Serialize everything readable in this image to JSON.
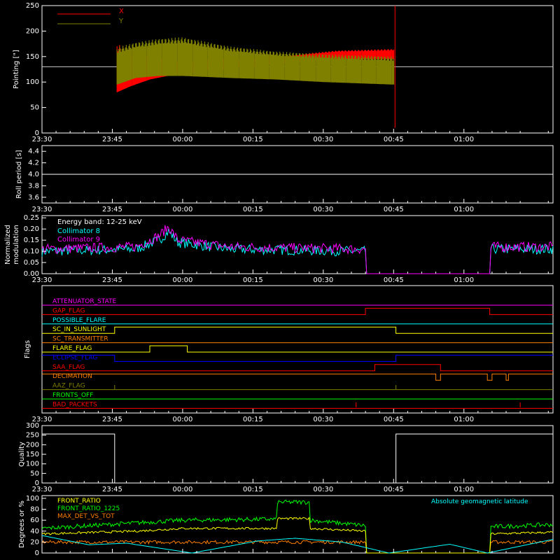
{
  "time_ticks": [
    "23:30",
    "23:45",
    "00:00",
    "00:15",
    "00:30",
    "00:45",
    "01:00"
  ],
  "panels": {
    "pointing": {
      "ylabel": "Pointing [\"]",
      "yticks": [
        "0",
        "50",
        "100",
        "150",
        "200",
        "250"
      ],
      "legend": [
        {
          "name": "X",
          "color": "#ff0000"
        },
        {
          "name": "Y",
          "color": "#7f7f00"
        }
      ]
    },
    "roll": {
      "ylabel": "Roll period [s]",
      "yticks": [
        "3.6",
        "3.8",
        "4.0",
        "4.2",
        "4.4"
      ]
    },
    "modulation": {
      "ylabel_line1": "Normalized",
      "ylabel_line2": "modulation",
      "yticks": [
        "0.00",
        "0.05",
        "0.10",
        "0.15",
        "0.20",
        "0.25"
      ],
      "energy_band": "Energy band: 12-25 keV",
      "legend": [
        {
          "name": "Collimator 8",
          "color": "#00ffff"
        },
        {
          "name": "Collimator 9",
          "color": "#ff00ff"
        }
      ]
    },
    "flags": {
      "ylabel": "Flags",
      "items": [
        {
          "label": "ATTENUATOR_STATE",
          "color": "#ff00ff"
        },
        {
          "label": "GAP_FLAG",
          "color": "#ff0000"
        },
        {
          "label": "POSSIBLE_FLARE",
          "color": "#00ffff"
        },
        {
          "label": "SC_IN_SUNLIGHT",
          "color": "#ffff00"
        },
        {
          "label": "SC_TRANSMITTER",
          "color": "#ff7f00"
        },
        {
          "label": "FLARE_FLAG",
          "color": "#ffff00"
        },
        {
          "label": "ECLIPSE_FLAG",
          "color": "#0000ff"
        },
        {
          "label": "SAA_FLAG",
          "color": "#ff0000"
        },
        {
          "label": "DECIMATION",
          "color": "#ff7f00"
        },
        {
          "label": "AAZ_FLAG",
          "color": "#7f7f00"
        },
        {
          "label": "FRONTS_OFF",
          "color": "#00ff00"
        },
        {
          "label": "BAD_PACKETS",
          "color": "#ff0000"
        }
      ]
    },
    "quality": {
      "ylabel": "Quality",
      "yticks": [
        "0",
        "50",
        "100",
        "150",
        "200",
        "250",
        "300"
      ]
    },
    "ratios": {
      "ylabel": "Degrees or %",
      "yticks": [
        "0",
        "20",
        "40",
        "60",
        "80",
        "100"
      ],
      "legend": [
        {
          "name": "FRONT_RATIO",
          "color": "#ffff00"
        },
        {
          "name": "FRONT_RATIO_1225",
          "color": "#00ff00"
        },
        {
          "name": "MAX_DET_VS_TOT",
          "color": "#ff7f00"
        }
      ],
      "right_legend": {
        "name": "Absolute geomagnetic latitude",
        "color": "#00ffff"
      }
    }
  },
  "chart_data": [
    {
      "type": "line",
      "title": "",
      "ylabel": "Pointing [\"]",
      "ylim": [
        0,
        250
      ],
      "x_range_minutes": [
        -30,
        79
      ],
      "series": [
        {
          "name": "X",
          "color": "#ff0000",
          "envelope": [
            [
              -14,
              80,
              175
            ],
            [
              -11,
              92,
              162
            ],
            [
              -7,
              105,
              150
            ],
            [
              0,
              118,
              142
            ],
            [
              15,
              130,
              148
            ],
            [
              25,
              140,
              155
            ],
            [
              33,
              145,
              162
            ],
            [
              45,
              145,
              165
            ]
          ]
        },
        {
          "name": "Y",
          "color": "#7f7f00",
          "envelope": [
            [
              -14,
              95,
              168
            ],
            [
              -10,
              108,
              178
            ],
            [
              -5,
              112,
              185
            ],
            [
              0,
              112,
              188
            ],
            [
              10,
              108,
              170
            ],
            [
              20,
              105,
              160
            ],
            [
              30,
              100,
              155
            ],
            [
              45,
              95,
              150
            ]
          ]
        }
      ],
      "reference_line": 130
    },
    {
      "type": "line",
      "ylabel": "Roll period [s]",
      "ylim": [
        3.5,
        4.5
      ],
      "series": [
        {
          "name": "",
          "values_const": 4.0
        }
      ]
    },
    {
      "type": "line",
      "ylabel": "Normalized modulation",
      "ylim": [
        0,
        0.25
      ],
      "series": [
        {
          "name": "Collimator 8",
          "color": "#00ffff",
          "base": [
            [
              -30,
              0.1
            ],
            [
              -10,
              0.11
            ],
            [
              -5,
              0.15
            ],
            [
              -3,
              0.19
            ],
            [
              -1,
              0.14
            ],
            [
              10,
              0.11
            ],
            [
              39,
              0.1
            ],
            [
              39.2,
              0
            ],
            [
              65.5,
              0
            ],
            [
              65.7,
              0.11
            ],
            [
              79,
              0.11
            ]
          ]
        },
        {
          "name": "Collimator 9",
          "color": "#ff00ff",
          "base": [
            [
              -30,
              0.11
            ],
            [
              -10,
              0.12
            ],
            [
              -5,
              0.17
            ],
            [
              -3,
              0.21
            ],
            [
              -1,
              0.15
            ],
            [
              10,
              0.12
            ],
            [
              39,
              0.11
            ],
            [
              39.2,
              0
            ],
            [
              65.5,
              0
            ],
            [
              65.7,
              0.12
            ],
            [
              79,
              0.12
            ]
          ]
        }
      ]
    },
    {
      "type": "line",
      "ylabel": "Flags",
      "series": [
        {
          "name": "ATTENUATOR_STATE",
          "steps": [
            [
              -30,
              0
            ]
          ]
        },
        {
          "name": "GAP_FLAG",
          "steps": [
            [
              -30,
              0
            ],
            [
              39,
              1
            ],
            [
              65.5,
              0
            ]
          ]
        },
        {
          "name": "POSSIBLE_FLARE",
          "steps": [
            [
              -30,
              0
            ]
          ]
        },
        {
          "name": "SC_IN_SUNLIGHT",
          "steps": [
            [
              -30,
              0
            ],
            [
              -14.5,
              1
            ],
            [
              45.5,
              0
            ]
          ]
        },
        {
          "name": "SC_TRANSMITTER",
          "steps": [
            [
              -30,
              0
            ]
          ]
        },
        {
          "name": "FLARE_FLAG",
          "steps": [
            [
              -30,
              0
            ],
            [
              -7,
              1
            ],
            [
              1,
              0
            ]
          ]
        },
        {
          "name": "ECLIPSE_FLAG",
          "steps": [
            [
              -30,
              1
            ],
            [
              -14.5,
              0
            ],
            [
              45.5,
              1
            ]
          ]
        },
        {
          "name": "SAA_FLAG",
          "steps": [
            [
              -30,
              0
            ],
            [
              41,
              1
            ],
            [
              55,
              0
            ]
          ]
        },
        {
          "name": "DECIMATION",
          "steps": [
            [
              -30,
              1
            ],
            [
              54,
              0
            ],
            [
              55,
              1
            ],
            [
              65,
              0
            ],
            [
              66,
              1
            ],
            [
              69,
              0
            ],
            [
              69.5,
              1
            ]
          ]
        },
        {
          "name": "AAZ_FLAG",
          "steps": [
            [
              -30,
              0
            ]
          ]
        },
        {
          "name": "FRONTS_OFF",
          "steps": [
            [
              -30,
              0
            ]
          ]
        },
        {
          "name": "BAD_PACKETS",
          "steps": [
            [
              -30,
              0
            ]
          ]
        }
      ]
    },
    {
      "type": "line",
      "ylabel": "Quality",
      "ylim": [
        0,
        300
      ],
      "series": [
        {
          "name": "",
          "steps": [
            [
              -30,
              256
            ],
            [
              -14.5,
              0
            ],
            [
              45.5,
              256
            ],
            [
              79,
              256
            ]
          ]
        }
      ]
    },
    {
      "type": "line",
      "ylabel": "Degrees or %",
      "ylim": [
        0,
        100
      ],
      "series": [
        {
          "name": "FRONT_RATIO",
          "color": "#ffff00",
          "base": [
            [
              -30,
              35
            ],
            [
              -10,
              40
            ],
            [
              0,
              45
            ],
            [
              20,
              45
            ],
            [
              20.2,
              63
            ],
            [
              27,
              63
            ],
            [
              27.2,
              45
            ],
            [
              39,
              40
            ],
            [
              39.2,
              0
            ],
            [
              65.5,
              0
            ],
            [
              65.7,
              35
            ],
            [
              79,
              38
            ]
          ]
        },
        {
          "name": "FRONT_RATIO_1225",
          "color": "#00ff00",
          "base": [
            [
              -30,
              45
            ],
            [
              -10,
              55
            ],
            [
              0,
              60
            ],
            [
              20,
              62
            ],
            [
              20.2,
              93
            ],
            [
              27,
              93
            ],
            [
              27.2,
              60
            ],
            [
              39,
              50
            ],
            [
              39.2,
              0
            ],
            [
              65.5,
              0
            ],
            [
              65.7,
              48
            ],
            [
              79,
              52
            ]
          ]
        },
        {
          "name": "MAX_DET_VS_TOT",
          "color": "#ff7f00",
          "base": [
            [
              -30,
              20
            ],
            [
              0,
              20
            ],
            [
              39,
              20
            ],
            [
              39.2,
              0
            ],
            [
              65.5,
              0
            ],
            [
              65.7,
              20
            ],
            [
              79,
              20
            ]
          ]
        },
        {
          "name": "Absolute geomagnetic latitude",
          "color": "#00ffff",
          "points": [
            [
              -30,
              32
            ],
            [
              -20,
              15
            ],
            [
              -12,
              18
            ],
            [
              2,
              0
            ],
            [
              16,
              22
            ],
            [
              24,
              27
            ],
            [
              34,
              20
            ],
            [
              44,
              0
            ],
            [
              57,
              16
            ],
            [
              65,
              0
            ],
            [
              79,
              25
            ]
          ]
        }
      ]
    }
  ]
}
